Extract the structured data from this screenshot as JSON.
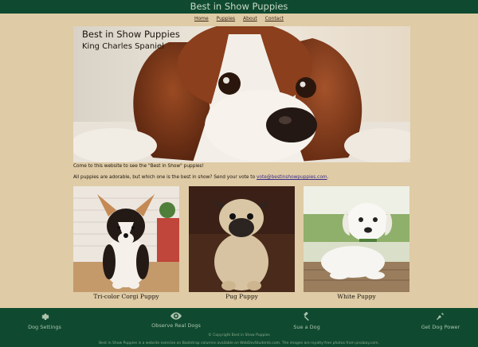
{
  "header": {
    "title": "Best in Show Puppies"
  },
  "nav": {
    "items": [
      "Home",
      "Puppies",
      "About",
      "Contact"
    ]
  },
  "hero": {
    "title": "Best in Show Puppies",
    "subtitle": "King Charles Spaniel"
  },
  "intro": {
    "line1": "Come to this website to see the \"Best in Show\" puppies!",
    "line2_prefix": "All puppies are adorable, but which one is the best in show? Send your vote to ",
    "email": "vote@bestinshowpuppies.com",
    "line2_suffix": "."
  },
  "puppies": [
    {
      "caption": "Tri-color Corgi Puppy"
    },
    {
      "caption": "Pug Puppy"
    },
    {
      "caption": "White Puppy"
    }
  ],
  "footer": {
    "links": [
      {
        "label": "Dog Settings",
        "icon": "gear-icon"
      },
      {
        "label": "Observe Real Dogs",
        "icon": "eye-icon"
      },
      {
        "label": "Sue a Dog",
        "icon": "gavel-icon"
      },
      {
        "label": "Get Dog Power",
        "icon": "plug-icon"
      }
    ],
    "copyright": "© Copyright Best in Show Puppies",
    "credit": "Best in Show Puppies is a website exercise on Bootstrap columns available on WebDevStudents.com. The images are royalty-free photos from pixabay.com."
  },
  "colors": {
    "bar": "#0f4a30",
    "background": "#dfcba5",
    "link": "#3b2c8a"
  }
}
